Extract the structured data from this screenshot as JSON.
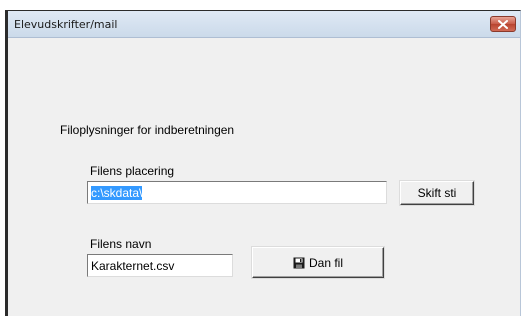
{
  "window": {
    "title": "Elevudskrifter/mail",
    "close_glyph": "✕"
  },
  "form": {
    "group_heading": "Filoplysninger for indberetningen",
    "location": {
      "label": "Filens placering",
      "value": "c:\\skdata\\",
      "button_label": "Skift sti"
    },
    "filename": {
      "label": "Filens navn",
      "value": "Karakternet.csv"
    },
    "create_button": {
      "label": "Dan fil",
      "icon": "floppy-disk-icon"
    }
  },
  "colors": {
    "selection": "#3399ff",
    "close_button": "#c85a47",
    "dialog_bg": "#f0f0f0"
  }
}
